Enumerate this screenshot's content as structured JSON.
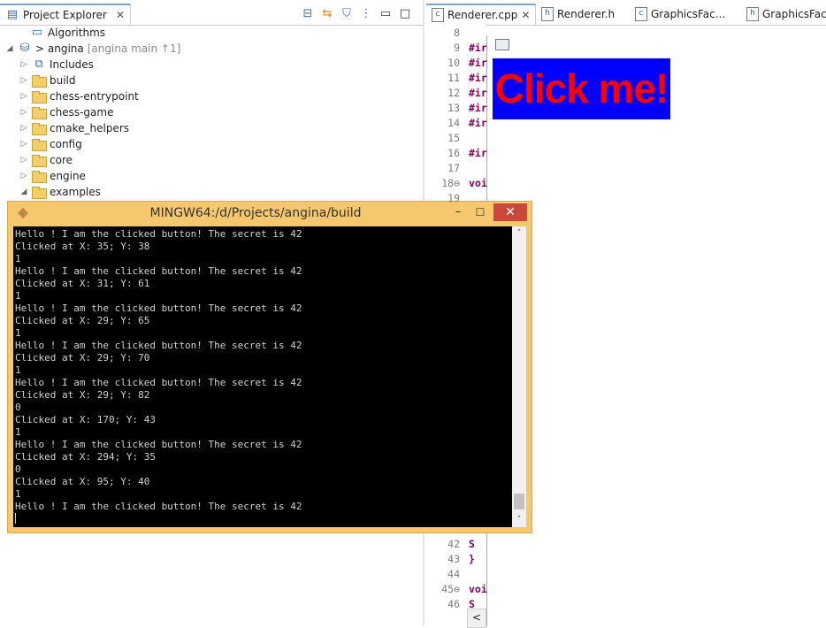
{
  "project_explorer": {
    "tab_label": "Project Explorer",
    "toolbar": [
      "collapse-all-icon",
      "link-editor-icon",
      "filter-icon",
      "view-menu-icon",
      "minimize-icon",
      "maximize-icon"
    ],
    "tree": [
      {
        "label": "Algorithms",
        "extra": "",
        "twisty": "",
        "indent": 0
      },
      {
        "label": "> angina",
        "extra": " [angina main ↑1]",
        "twisty": "◢",
        "indent": 0
      },
      {
        "label": "Includes",
        "extra": "",
        "twisty": "▷",
        "indent": 1
      },
      {
        "label": "build",
        "extra": "",
        "twisty": "▷",
        "indent": 1
      },
      {
        "label": "chess-entrypoint",
        "extra": "",
        "twisty": "▷",
        "indent": 1
      },
      {
        "label": "chess-game",
        "extra": "",
        "twisty": "▷",
        "indent": 1
      },
      {
        "label": "cmake_helpers",
        "extra": "",
        "twisty": "▷",
        "indent": 1
      },
      {
        "label": "config",
        "extra": "",
        "twisty": "▷",
        "indent": 1
      },
      {
        "label": "core",
        "extra": "",
        "twisty": "▷",
        "indent": 1
      },
      {
        "label": "engine",
        "extra": "",
        "twisty": "▷",
        "indent": 1
      },
      {
        "label": "examples",
        "extra": "",
        "twisty": "◢",
        "indent": 1
      }
    ]
  },
  "editor": {
    "tabs": [
      {
        "label": "Renderer.cpp",
        "icon": "c",
        "close": "✕"
      },
      {
        "label": "Renderer.h",
        "icon": "h",
        "close": ""
      },
      {
        "label": "GraphicsFac...",
        "icon": "c",
        "close": ""
      },
      {
        "label": "GraphicsFac...",
        "icon": "h",
        "close": ""
      }
    ],
    "top_lines": [
      {
        "n": "8",
        "code": ""
      },
      {
        "n": "9",
        "code": "#ir"
      },
      {
        "n": "10",
        "code": "#ir"
      },
      {
        "n": "11",
        "code": "#ir"
      },
      {
        "n": "12",
        "code": "#ir"
      },
      {
        "n": "13",
        "code": "#ir"
      },
      {
        "n": "14",
        "code": "#ir"
      },
      {
        "n": "15",
        "code": ""
      },
      {
        "n": "16",
        "code": "#ir"
      },
      {
        "n": "17",
        "code": ""
      },
      {
        "n": "18⊖",
        "code": "voi"
      },
      {
        "n": "19",
        "code": "  "
      }
    ],
    "bottom_lines": [
      {
        "n": "42",
        "code": "  S"
      },
      {
        "n": "43",
        "code": "}"
      },
      {
        "n": "44",
        "code": ""
      },
      {
        "n": "45⊖",
        "code": "voi"
      },
      {
        "n": "46",
        "code": "  S"
      }
    ],
    "scroll_left": "<"
  },
  "app_window": {
    "button_label": "Click me!",
    "button_bg": "#0000ff",
    "button_fg": "#ff0000"
  },
  "terminal": {
    "title": "MINGW64:/d/Projects/angina/build",
    "minimize": "–",
    "maximize": "☐",
    "close": "✕",
    "lines": [
      "Hello ! I am the clicked button! The secret is 42",
      "Clicked at X: 35; Y: 38",
      "1",
      "Hello ! I am the clicked button! The secret is 42",
      "Clicked at X: 31; Y: 61",
      "1",
      "Hello ! I am the clicked button! The secret is 42",
      "Clicked at X: 29; Y: 65",
      "1",
      "Hello ! I am the clicked button! The secret is 42",
      "Clicked at X: 29; Y: 70",
      "1",
      "Hello ! I am the clicked button! The secret is 42",
      "Clicked at X: 29; Y: 82",
      "0",
      "Clicked at X: 170; Y: 43",
      "1",
      "Hello ! I am the clicked button! The secret is 42",
      "Clicked at X: 294; Y: 35",
      "0",
      "Clicked at X: 95; Y: 40",
      "1",
      "Hello ! I am the clicked button! The secret is 42"
    ],
    "scroll_up": "˄",
    "scroll_down": "˅"
  }
}
